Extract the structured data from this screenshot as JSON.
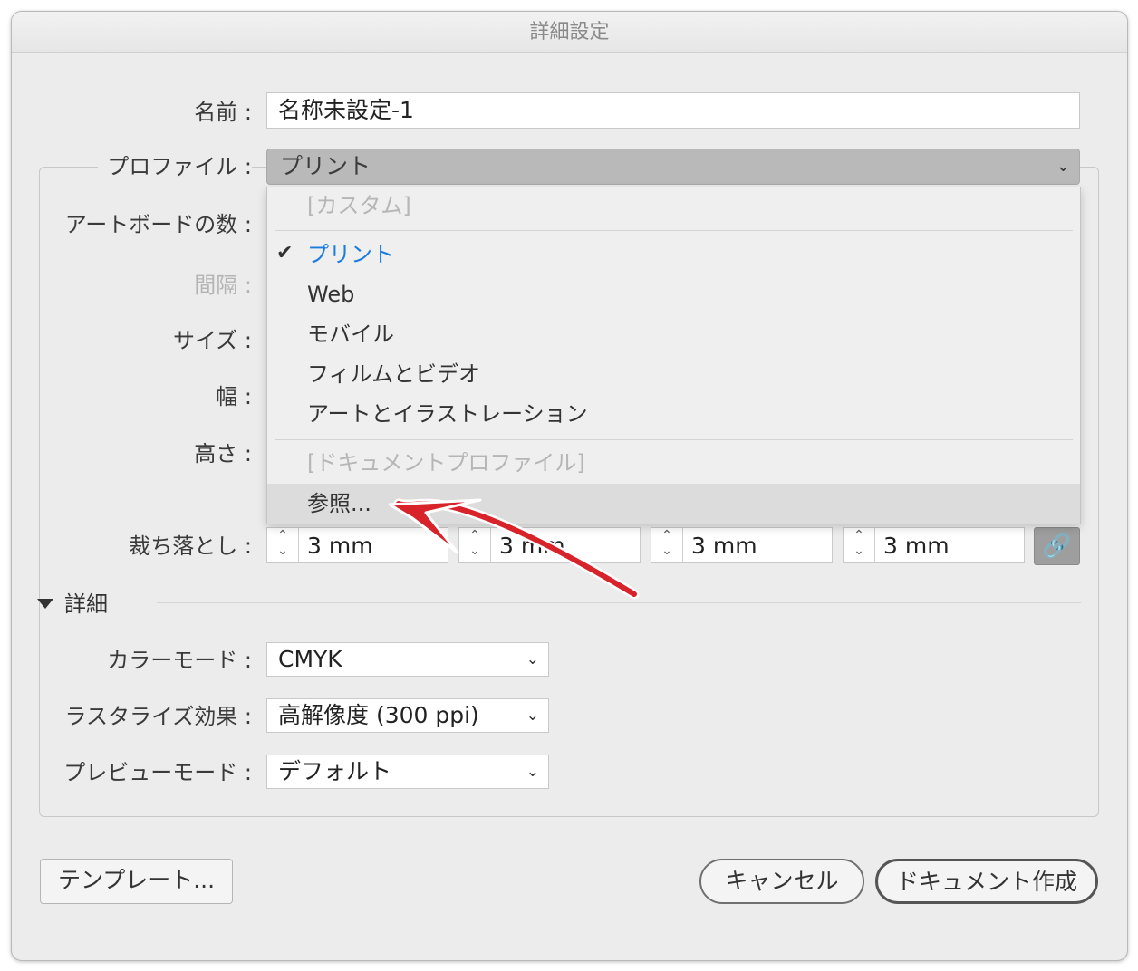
{
  "window": {
    "title": "詳細設定"
  },
  "form": {
    "name_label": "名前 :",
    "name_value": "名称未設定-1",
    "profile_label": "プロファイル :",
    "profile_value": "プリント",
    "artboards_label": "アートボードの数 :",
    "spacing_label": "間隔 :",
    "size_label": "サイズ :",
    "width_label": "幅 :",
    "height_label": "高さ :",
    "bleed_label": "裁ち落とし :",
    "bleed_values": [
      "3 mm",
      "3 mm",
      "3 mm",
      "3 mm"
    ]
  },
  "profile_menu": {
    "items": [
      {
        "label": "[カスタム]",
        "state": "disabled"
      },
      {
        "label": "プリント",
        "state": "selected"
      },
      {
        "label": "Web",
        "state": "normal"
      },
      {
        "label": "モバイル",
        "state": "normal"
      },
      {
        "label": "フィルムとビデオ",
        "state": "normal"
      },
      {
        "label": "アートとイラストレーション",
        "state": "normal"
      },
      {
        "label": "[ドキュメントプロファイル]",
        "state": "disabled"
      },
      {
        "label": "参照...",
        "state": "highlighted"
      }
    ]
  },
  "advanced": {
    "heading": "詳細",
    "color_mode_label": "カラーモード :",
    "color_mode_value": "CMYK",
    "raster_label": "ラスタライズ効果 :",
    "raster_value": "高解像度 (300 ppi)",
    "preview_label": "プレビューモード :",
    "preview_value": "デフォルト"
  },
  "buttons": {
    "templates": "テンプレート...",
    "cancel": "キャンセル",
    "create": "ドキュメント作成"
  },
  "colors": {
    "accent": "#1a7ce0",
    "annotation_arrow": "#d8232a"
  }
}
